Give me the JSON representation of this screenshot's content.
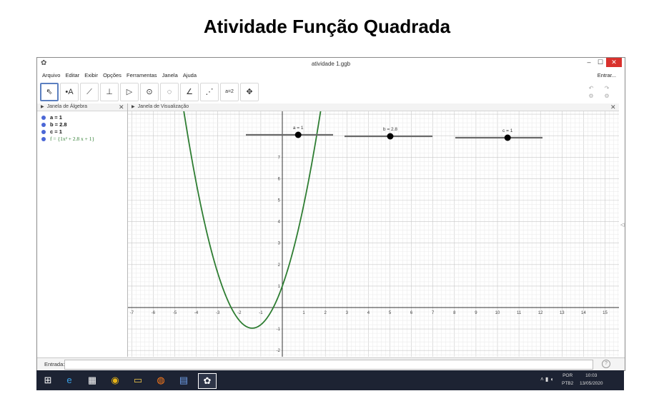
{
  "page": {
    "title": "Atividade Função Quadrada"
  },
  "window": {
    "app_icon": "geogebra-icon",
    "title": "atividade 1.ggb",
    "minimize": "–",
    "maximize": "☐",
    "close": "✕"
  },
  "menubar": {
    "items": [
      "Arquivo",
      "Editar",
      "Exibir",
      "Opções",
      "Ferramentas",
      "Janela",
      "Ajuda"
    ],
    "login": "Entrar..."
  },
  "toolbar": {
    "tools": [
      {
        "name": "move-tool-icon",
        "glyph": "⇖"
      },
      {
        "name": "point-tool-icon",
        "glyph": "•A"
      },
      {
        "name": "line-tool-icon",
        "glyph": "⟋"
      },
      {
        "name": "perpendicular-tool-icon",
        "glyph": "⊥"
      },
      {
        "name": "polygon-tool-icon",
        "glyph": "▷"
      },
      {
        "name": "circle-tool-icon",
        "glyph": "⊙"
      },
      {
        "name": "conic-tool-icon",
        "glyph": "◌"
      },
      {
        "name": "angle-tool-icon",
        "glyph": "∠"
      },
      {
        "name": "reflect-tool-icon",
        "glyph": "⋰"
      },
      {
        "name": "slider-tool-icon",
        "glyph": "a=2"
      },
      {
        "name": "move-view-tool-icon",
        "glyph": "✥"
      }
    ],
    "undo": "↶",
    "redo": "↷",
    "settings": "⚙"
  },
  "algebra_panel": {
    "header": "Janela de Álgebra",
    "items": [
      {
        "text": "a = 1"
      },
      {
        "text": "b = 2.8"
      },
      {
        "text": "c = 1"
      },
      {
        "text": "f = {1x² + 2.8 x + 1}"
      }
    ]
  },
  "graphics_panel": {
    "header": "Janela de Visualização",
    "sliders": [
      {
        "label": "a = 1",
        "value": 1,
        "min": -5,
        "max": 5
      },
      {
        "label": "b = 2.8",
        "value": 2.8,
        "min": -5,
        "max": 10
      },
      {
        "label": "c = 1",
        "value": 1,
        "min": -5,
        "max": 5
      }
    ],
    "x_ticks": [
      "-7",
      "-6",
      "-5",
      "-4",
      "-3",
      "-2",
      "-1",
      "0",
      "1",
      "2",
      "3",
      "4",
      "5",
      "6",
      "7",
      "8",
      "9",
      "10",
      "11",
      "12",
      "13",
      "14",
      "15"
    ],
    "y_ticks": [
      "-2",
      "-1",
      "1",
      "2",
      "3",
      "4",
      "5",
      "6",
      "7"
    ],
    "curve_color": "#2e7d32",
    "function": {
      "a": 1,
      "b": 2.8,
      "c": 1
    }
  },
  "input_bar": {
    "label": "Entrada:",
    "help": "?"
  },
  "taskbar": {
    "icons": [
      "windows-start-icon",
      "ie-icon",
      "file-icon",
      "chrome-icon",
      "folder-icon",
      "firefox-icon",
      "word-icon",
      "geogebra-taskbar-icon"
    ],
    "lang_line1": "POR",
    "lang_line2": "PTB2",
    "time": "10:03",
    "date": "13/05/2020"
  }
}
